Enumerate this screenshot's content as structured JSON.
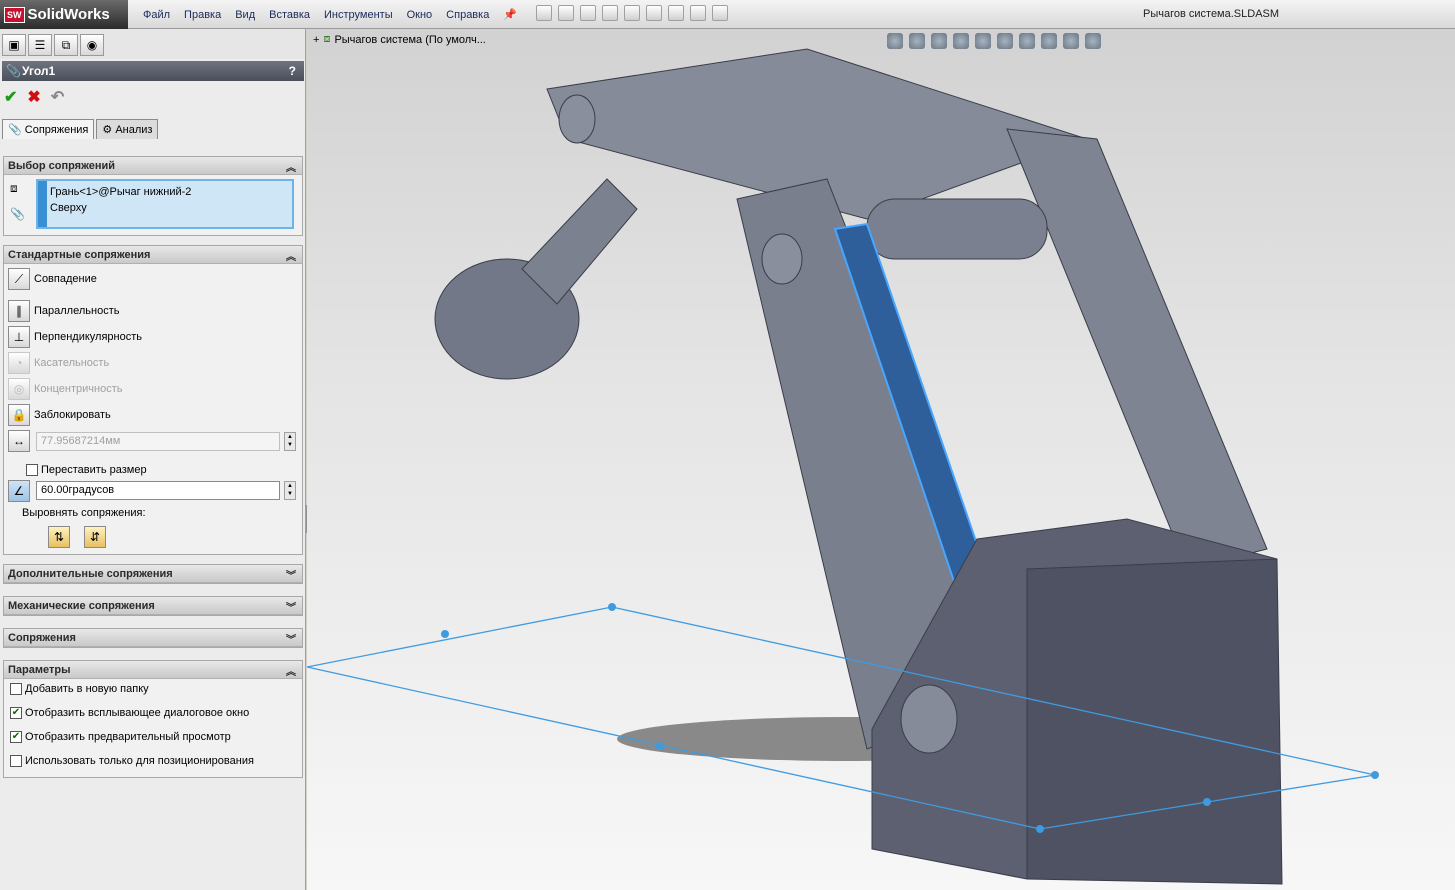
{
  "app": {
    "logo": "SolidWorks",
    "logo_badge": "SW",
    "document_title": "Рычагов система.SLDASM"
  },
  "menu": [
    "Файл",
    "Правка",
    "Вид",
    "Вставка",
    "Инструменты",
    "Окно",
    "Справка"
  ],
  "toolbar_icons": [
    "new-icon",
    "open-icon",
    "save-icon",
    "print-icon",
    "undo-icon",
    "select-icon",
    "rebuild-icon",
    "file-props-icon",
    "options-icon"
  ],
  "property_manager": {
    "title": "Угол1",
    "help": "?",
    "subtabs": [
      "Сопряжения",
      "Анализ"
    ]
  },
  "mate_selection": {
    "header": "Выбор сопряжений",
    "items": [
      "Грань<1>@Рычаг нижний-2",
      "Сверху"
    ]
  },
  "standard_mates": {
    "header": "Стандартные сопряжения",
    "coincident": "Совпадение",
    "parallel": "Параллельность",
    "perpendicular": "Перпендикулярность",
    "tangent": "Касательность",
    "concentric": "Концентричность",
    "lock": "Заблокировать",
    "distance_value": "77.95687214мм",
    "flip_dimension": "Переставить размер",
    "angle_value": "60.00градусов",
    "align_label": "Выровнять сопряжения:"
  },
  "collapsed_sections": [
    "Дополнительные сопряжения",
    "Механические сопряжения",
    "Сопряжения"
  ],
  "options": {
    "header": "Параметры",
    "items": [
      {
        "label": "Добавить в новую папку",
        "checked": false
      },
      {
        "label": "Отобразить всплывающее диалоговое окно",
        "checked": true
      },
      {
        "label": "Отобразить предварительный просмотр",
        "checked": true
      },
      {
        "label": "Использовать только для позиционирования",
        "checked": false
      }
    ]
  },
  "viewport": {
    "tree_label": "Рычагов система  (По умолч..."
  },
  "colors": {
    "accent_selection": "#3a8fd3",
    "model_gray": "#7a7f8e",
    "selected_face": "#2f5f9a"
  }
}
